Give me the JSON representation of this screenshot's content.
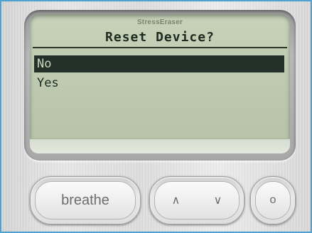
{
  "device": {
    "brand": "StressEraser",
    "screen": {
      "title": "Reset Device?",
      "items": [
        {
          "label": "No",
          "selected": true
        },
        {
          "label": "Yes",
          "selected": false
        }
      ]
    },
    "buttons": {
      "breathe": "breathe",
      "up": "∧",
      "down": "∨",
      "ok": "o"
    },
    "colors": {
      "lcd_background": "#bcc8ad",
      "lcd_text": "#1f2b22",
      "selection_bar": "#243129",
      "frame_border": "#4aa3d3"
    }
  }
}
